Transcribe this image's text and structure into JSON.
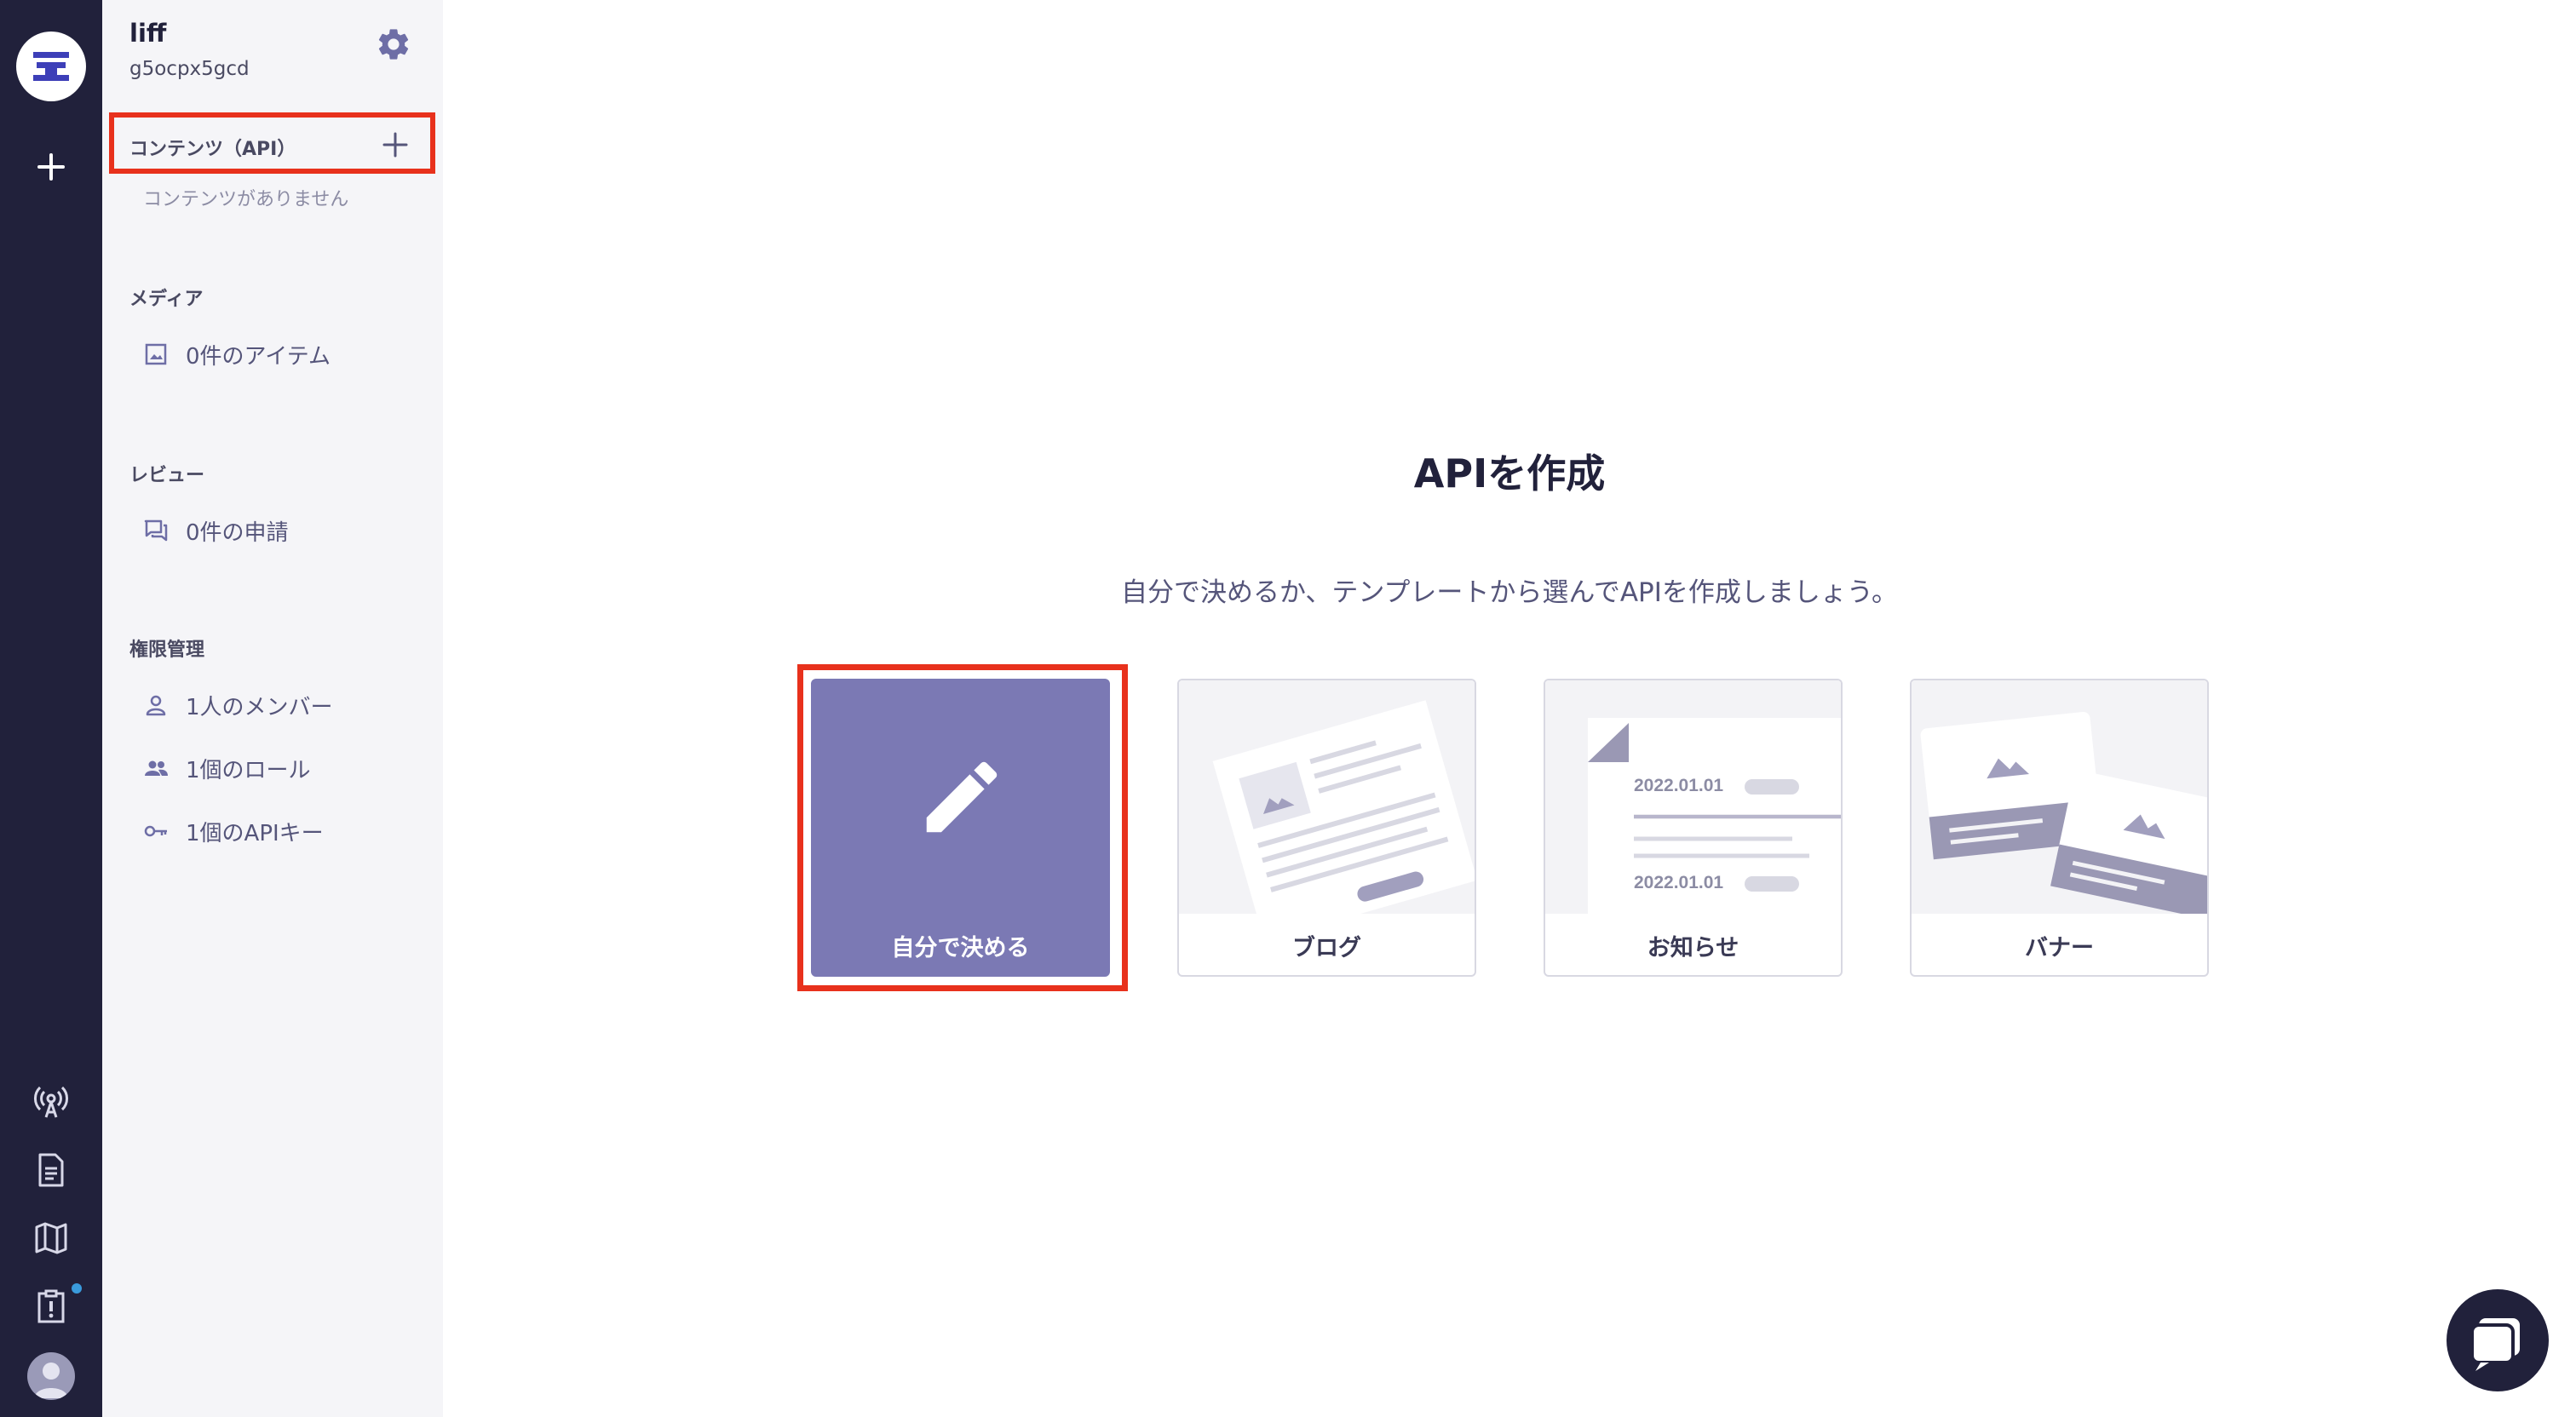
{
  "service": {
    "name": "liff",
    "id": "g5ocpx5gcd"
  },
  "sidebar": {
    "content_section": {
      "title": "コンテンツ（API）",
      "empty_message": "コンテンツがありません"
    },
    "media_section": {
      "title": "メディア",
      "items": [
        {
          "label": "0件のアイテム",
          "icon": "image-icon"
        }
      ]
    },
    "review_section": {
      "title": "レビュー",
      "items": [
        {
          "label": "0件の申請",
          "icon": "chat-bubbles-icon"
        }
      ]
    },
    "permission_section": {
      "title": "権限管理",
      "items": [
        {
          "label": "1人のメンバー",
          "icon": "person-icon"
        },
        {
          "label": "1個のロール",
          "icon": "people-icon"
        },
        {
          "label": "1個のAPIキー",
          "icon": "key-icon"
        }
      ]
    }
  },
  "main": {
    "title": "APIを作成",
    "subtitle": "自分で決めるか、テンプレートから選んでAPIを作成しましょう。",
    "cards": [
      {
        "label": "自分で決める",
        "icon": "pencil-icon",
        "selected": true
      },
      {
        "label": "ブログ",
        "icon": "blog-illustration"
      },
      {
        "label": "お知らせ",
        "icon": "news-illustration",
        "dates": [
          "2022.01.01",
          "2022.01.01"
        ]
      },
      {
        "label": "バナー",
        "icon": "banner-illustration"
      }
    ]
  },
  "colors": {
    "rail": "#21213b",
    "sidebar": "#f5f5f8",
    "accent": "#7b79b4",
    "highlight": "#e8311c"
  }
}
